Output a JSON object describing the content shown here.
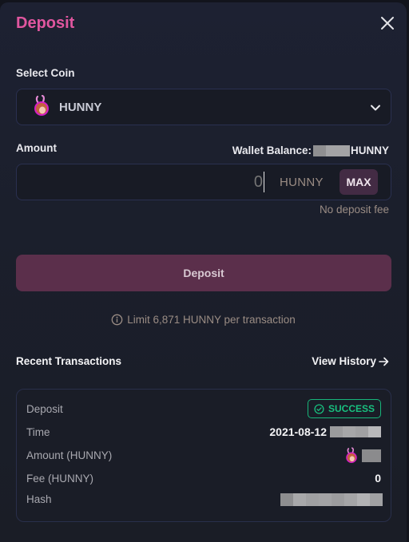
{
  "modal": {
    "title": "Deposit",
    "close_icon": "close-icon"
  },
  "select_coin": {
    "label": "Select Coin",
    "selected": "HUNNY",
    "icon": "hunny-coin-icon"
  },
  "amount": {
    "label": "Amount",
    "wallet_balance_label": "Wallet Balance:",
    "wallet_balance_unit": "HUNNY",
    "input_placeholder": "0",
    "input_value": "",
    "unit": "HUNNY",
    "max_label": "MAX",
    "fee_note": "No deposit fee"
  },
  "deposit_button": {
    "label": "Deposit"
  },
  "limit": {
    "text": "Limit 6,871 HUNNY per transaction",
    "icon": "info-icon"
  },
  "recent": {
    "title": "Recent Transactions",
    "view_history_label": "View History",
    "transaction": {
      "type_label": "Deposit",
      "status": "SUCCESS",
      "time_label": "Time",
      "time_value": "2021-08-12",
      "amount_label": "Amount (HUNNY)",
      "fee_label": "Fee (HUNNY)",
      "fee_value": "0",
      "hash_label": "Hash"
    }
  },
  "colors": {
    "accent": "#e0569f",
    "button": "#5b2f4b",
    "success": "#18c07f"
  }
}
